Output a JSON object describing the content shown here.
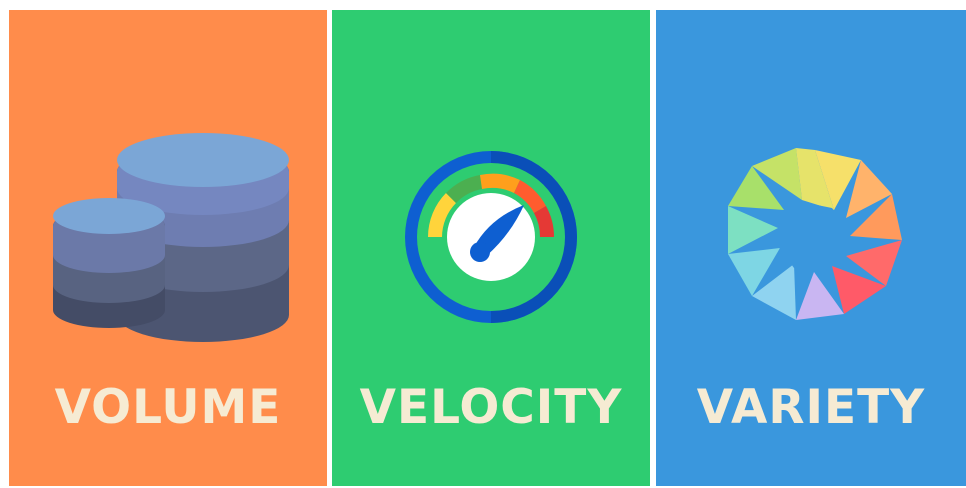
{
  "panels": [
    {
      "id": "volume",
      "title": "VOLUME",
      "background": "#FF8C4B",
      "title_color": "#F6EBD3",
      "icon": "database-icon"
    },
    {
      "id": "velocity",
      "title": "VELOCITY",
      "background": "#2ECC71",
      "title_color": "#F6EBD3",
      "icon": "speedometer-icon"
    },
    {
      "id": "variety",
      "title": "VARIETY",
      "background": "#3A97DD",
      "title_color": "#F6EBD3",
      "icon": "camera-aperture-icon"
    }
  ]
}
